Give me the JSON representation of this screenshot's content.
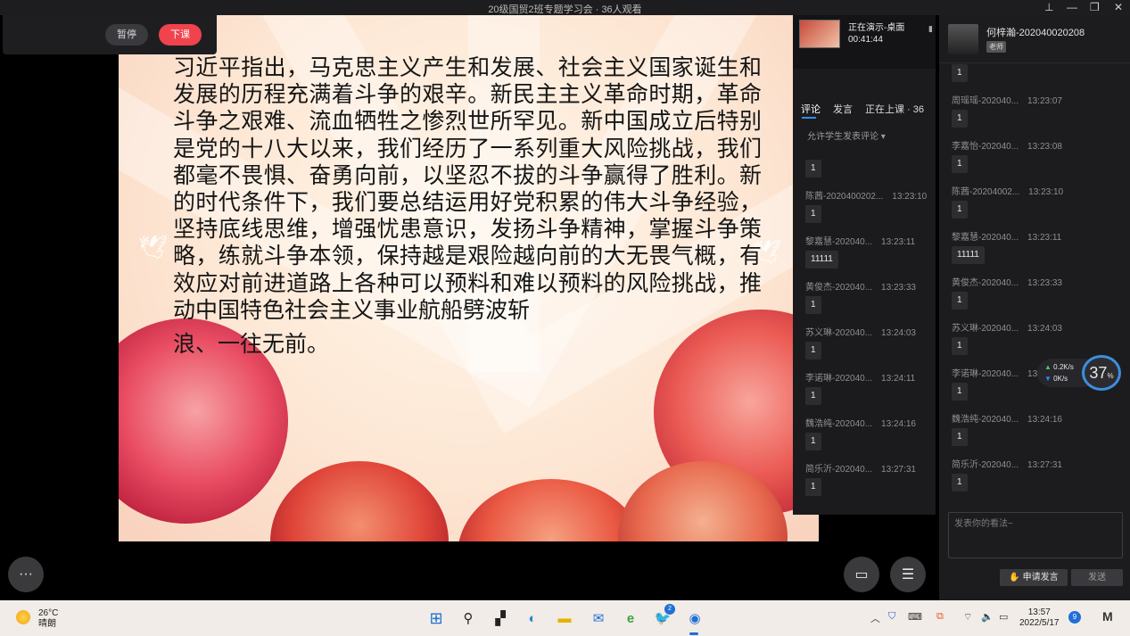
{
  "window": {
    "title": "20级国贸2班专题学习会 · 36人观看",
    "controls": [
      "⊥",
      "—",
      "❐",
      "✕"
    ]
  },
  "control_bar": {
    "pause_label": "暂停",
    "end_label": "下课"
  },
  "slide": {
    "paragraph": "习近平指出，马克思主义产生和发展、社会主义国家诞生和发展的历程充满着斗争的艰辛。新民主主义革命时期，革命斗争之艰难、流血牺牲之惨烈世所罕见。新中国成立后特别是党的十八大以来，我们经历了一系列重大风险挑战，我们都毫不畏惧、奋勇向前，以坚忍不拔的斗争赢得了胜利。新的时代条件下，我们要总结运用好党积累的伟大斗争经验，坚持底线思维，增强忧患意识，发扬斗争精神，掌握斗争策略，练就斗争本领，保持越是艰险越向前的大无畏气概，有效应对前进道路上各种可以预料和难以预料的风险挑战，推动中国特色社会主义事业航船劈波斩",
    "tail": "浪、一往无前。"
  },
  "presenting": {
    "status": "正在演示-桌面",
    "duration": "00:41:44"
  },
  "mid_panel": {
    "tabs": [
      "评论",
      "发言",
      "正在上课 · 36"
    ],
    "allow_label": "允许学生发表评论",
    "comments": [
      {
        "name": "",
        "time": "",
        "message": "1"
      },
      {
        "name": "陈茜-2020400202...",
        "time": "13:23:10",
        "message": "1"
      },
      {
        "name": "黎嘉慧-202040...",
        "time": "13:23:11",
        "message": "11111"
      },
      {
        "name": "黄俊杰-202040...",
        "time": "13:23:33",
        "message": "1"
      },
      {
        "name": "苏义琳-202040...",
        "time": "13:24:03",
        "message": "1"
      },
      {
        "name": "李诺琳-202040...",
        "time": "13:24:11",
        "message": "1"
      },
      {
        "name": "魏浩纯-202040...",
        "time": "13:24:16",
        "message": "1"
      },
      {
        "name": "简乐沂-202040...",
        "time": "13:27:31",
        "message": "1"
      }
    ]
  },
  "right_panel": {
    "teacher_name": "何梓瀚-202040020208",
    "teacher_badge": "老师",
    "comments": [
      {
        "name": "",
        "time": "",
        "message": "1"
      },
      {
        "name": "周瑶瑶-202040...",
        "time": "13:23:07",
        "message": "1"
      },
      {
        "name": "李嘉怡-202040...",
        "time": "13:23:08",
        "message": "1"
      },
      {
        "name": "陈茜-20204002...",
        "time": "13:23:10",
        "message": "1"
      },
      {
        "name": "黎嘉慧-202040...",
        "time": "13:23:11",
        "message": "11111"
      },
      {
        "name": "黄俊杰-202040...",
        "time": "13:23:33",
        "message": "1"
      },
      {
        "name": "苏义琳-202040...",
        "time": "13:24:03",
        "message": "1"
      },
      {
        "name": "李诺琳-202040...",
        "time": "13",
        "message": "1"
      },
      {
        "name": "魏浩纯-202040...",
        "time": "13:24:16",
        "message": "1"
      },
      {
        "name": "简乐沂-202040...",
        "time": "13:27:31",
        "message": "1"
      }
    ],
    "input_placeholder": "发表你的看法~",
    "raise_hand_label": "申请发言",
    "send_label": "发送"
  },
  "net_widget": {
    "upload": "0.2",
    "download": "0",
    "unit": "K/s",
    "percent": "37",
    "percent_sign": "%"
  },
  "taskbar": {
    "temperature": "26°C",
    "weather": "晴朗",
    "time": "13:57",
    "date": "2022/5/17",
    "notifications": "9",
    "twitter_badge": "2"
  },
  "colors": {
    "end_button": "#f0434d",
    "accent": "#2e8cf0",
    "panel": "#1b1b1d"
  }
}
